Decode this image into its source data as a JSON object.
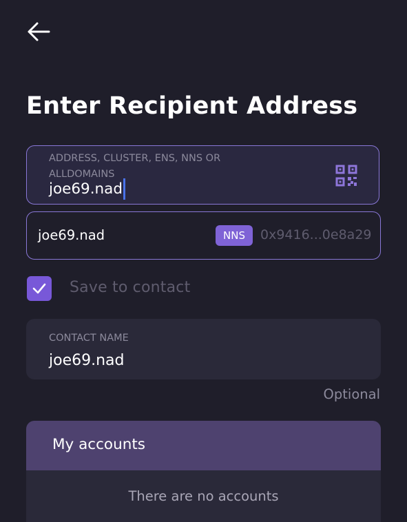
{
  "header": {
    "back_icon": "arrow-left-icon",
    "title": "Enter Recipient Address"
  },
  "address_input": {
    "label_line1": "ADDRESS, CLUSTER, ENS, NNS OR",
    "label_line2": "ALLDOMAINS",
    "value": "joe69.nad",
    "scan_icon": "qr-code-icon"
  },
  "resolved_result": {
    "name": "joe69.nad",
    "badge": "NNS",
    "address": "0x9416...0e8a29"
  },
  "save_contact": {
    "checked": true,
    "label": "Save to contact",
    "icon": "checkmark-icon"
  },
  "contact_name": {
    "label": "CONTACT NAME",
    "value": "joe69.nad",
    "hint": "Optional"
  },
  "accounts": {
    "title": "My accounts",
    "empty_text": "There are no accounts"
  },
  "colors": {
    "background": "#1f1e2a",
    "accent": "#7858d8",
    "border": "#8a78d8",
    "badge": "#7f63d6",
    "accounts_header": "#4e426f",
    "caret": "#4a73e8"
  }
}
